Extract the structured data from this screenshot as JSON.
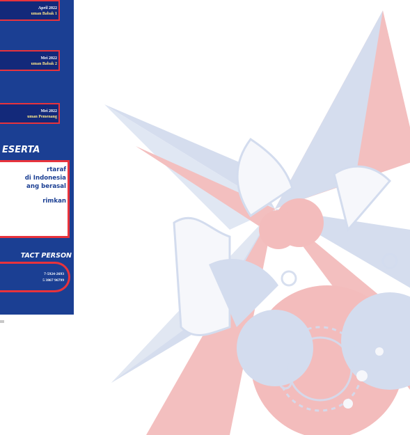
{
  "colors": {
    "poster_blue": "#1b3f93",
    "dark_blue": "#13297a",
    "accent_red": "#e8333c",
    "watermark_blue": "#d3dcee",
    "watermark_red": "#f3bcbc"
  },
  "watermark": {
    "icon": "compass-star-logo-icon"
  },
  "schedule": [
    {
      "date": "April 2022",
      "label": "uman Babak 1"
    },
    {
      "date": "Mei 2022",
      "label": "uman Babak 2"
    },
    {
      "date": "Mei 2022",
      "label": "uman Pemenang"
    }
  ],
  "peserta": {
    "title": "ESERTA",
    "lines": [
      "rtaraf",
      "di Indonesia",
      "ang berasal",
      "",
      "rimkan"
    ]
  },
  "contact": {
    "title": "TACT PERSON",
    "phones": [
      "7-5924-2693",
      "5 3867 96799"
    ]
  }
}
